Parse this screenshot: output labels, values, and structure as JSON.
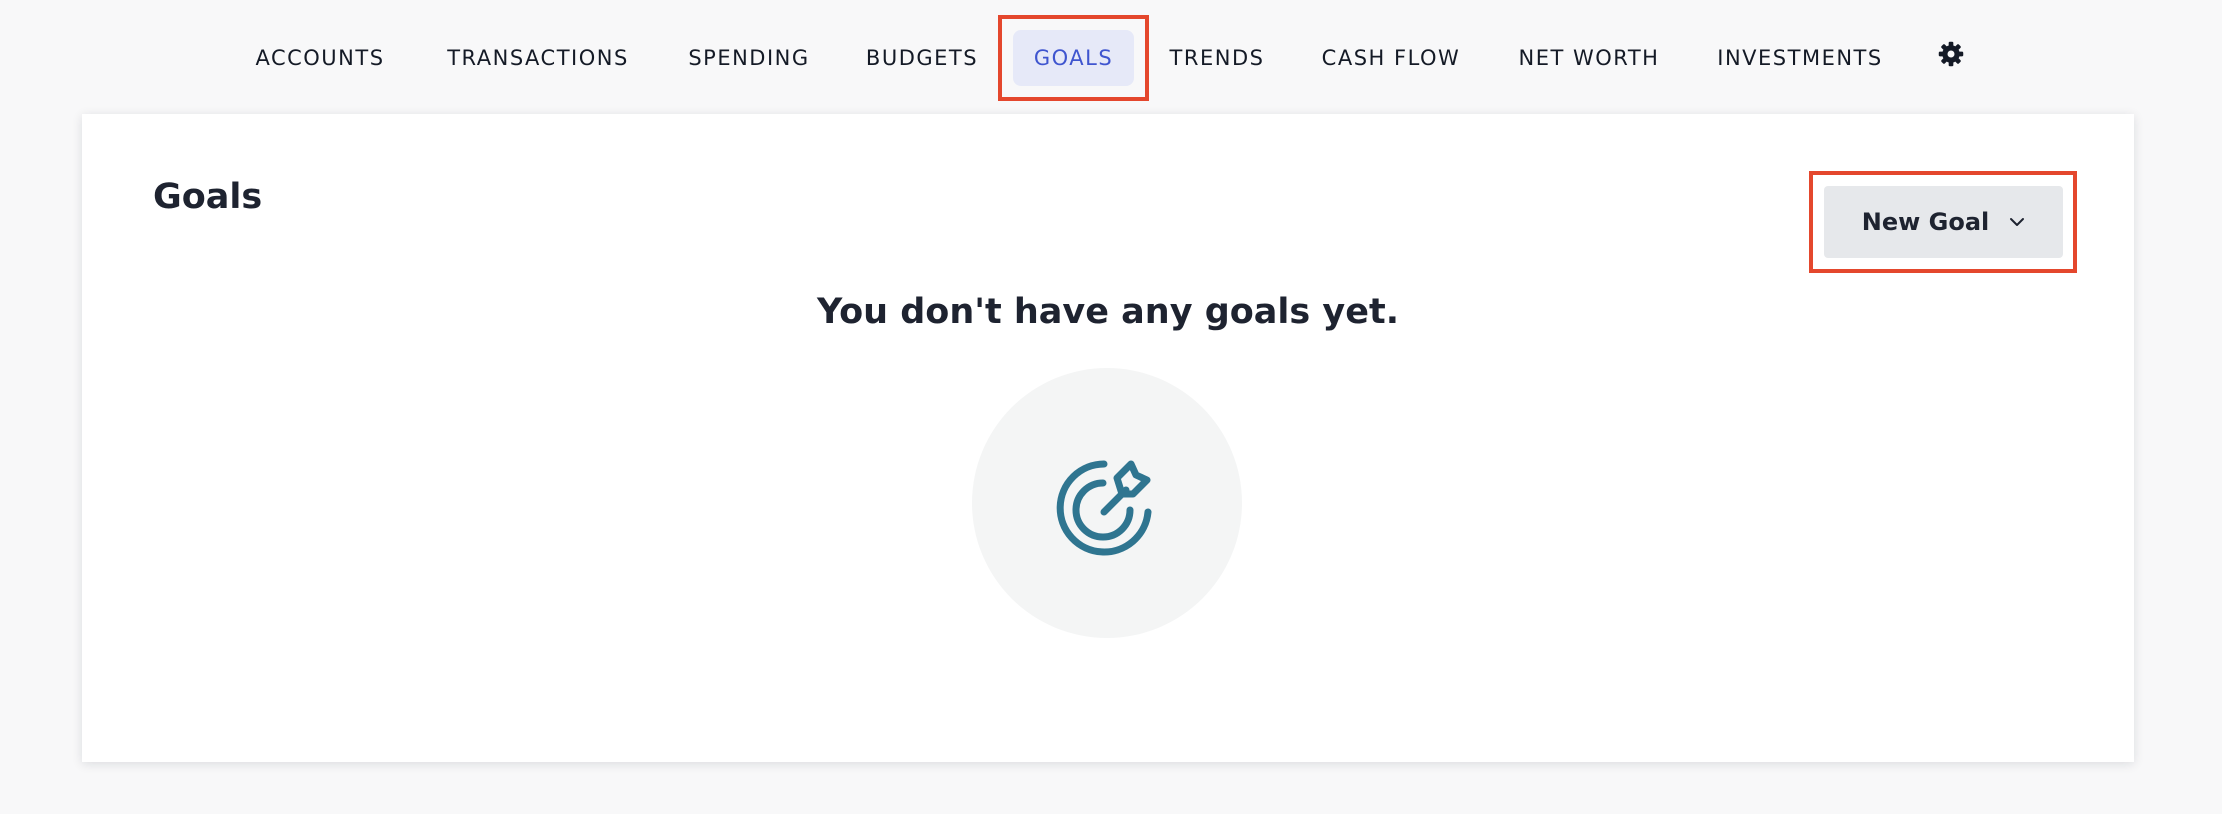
{
  "nav": {
    "items": [
      {
        "label": "ACCOUNTS"
      },
      {
        "label": "TRANSACTIONS"
      },
      {
        "label": "SPENDING"
      },
      {
        "label": "BUDGETS"
      },
      {
        "label": "GOALS",
        "active": true
      },
      {
        "label": "TRENDS"
      },
      {
        "label": "CASH FLOW"
      },
      {
        "label": "NET WORTH"
      },
      {
        "label": "INVESTMENTS"
      }
    ],
    "settings_icon": "gear-icon"
  },
  "page": {
    "title": "Goals",
    "new_goal_label": "New Goal",
    "new_goal_icon": "chevron-down-icon"
  },
  "empty_state": {
    "message": "You don't have any goals yet.",
    "icon": "target-arrow-icon"
  },
  "colors": {
    "active_nav_bg": "#e6e9f8",
    "active_nav_text": "#3f55cf",
    "highlight": "#e4472d",
    "icon": "#2f7590"
  }
}
